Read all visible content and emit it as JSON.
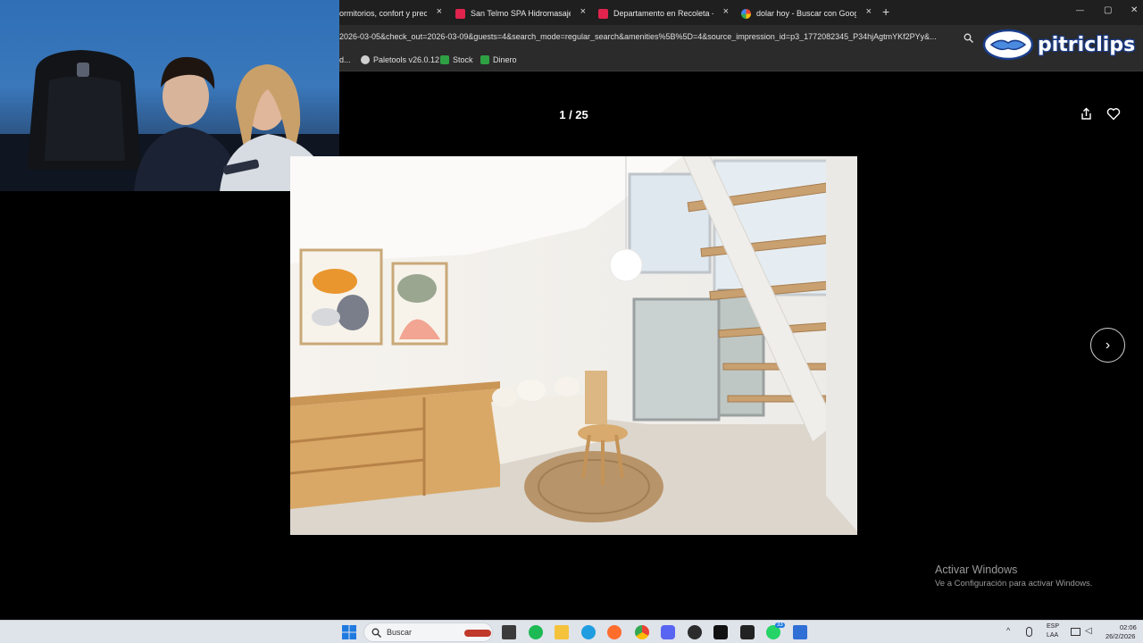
{
  "browser": {
    "tabs": [
      {
        "title": "ormitorios, confort y precio",
        "favicon_color": "#e0244d"
      },
      {
        "title": "San Telmo SPA Hidromasaje, Sa",
        "favicon_color": "#e0244d"
      },
      {
        "title": "Departamento en Recoleta - De",
        "favicon_color": "#e0244d"
      },
      {
        "title": "dolar hoy - Buscar con Google",
        "favicon_color": "#ffffff"
      }
    ],
    "close_glyph": "×",
    "new_tab_glyph": "+",
    "window_controls": {
      "minimize": "—",
      "maximize": "▢",
      "close": "✕"
    },
    "url": "2026-03-05&check_out=2026-03-09&guests=4&search_mode=regular_search&amenities%5B%5D=4&source_impression_id=p3_1772082345_P34hjAgtmYKf2PYy&...",
    "bookmarks": [
      {
        "label": "d...",
        "color": "#888888"
      },
      {
        "label": "Paletools v26.0.12",
        "color": "#cfcfcf"
      },
      {
        "label": "Stock",
        "color": "#2ea043"
      },
      {
        "label": "Dinero",
        "color": "#2ea043"
      }
    ]
  },
  "watermark": {
    "text": "pitriclips"
  },
  "gallery": {
    "counter": "1 / 25",
    "share_icon": "share-icon",
    "save_icon": "heart-icon",
    "next_glyph": "›"
  },
  "windows_notice": {
    "title": "Activar Windows",
    "subtitle": "Ve a Configuración para activar Windows."
  },
  "taskbar": {
    "search_placeholder": "Buscar",
    "lang_1": "ESP",
    "lang_2": "LAA",
    "time": "02:06",
    "date": "26/2/2026",
    "badge": "33"
  },
  "colors": {
    "accent": "#e0244d",
    "taskbar": "#dfe3ea"
  }
}
